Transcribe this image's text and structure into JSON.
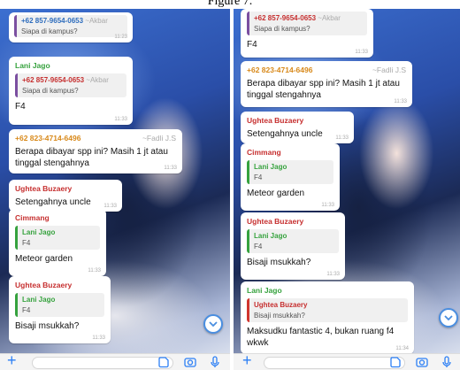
{
  "caption": "Figure 7.",
  "left_chat": {
    "messages": [
      {
        "quote_sender": "+62 857-9654-0653",
        "quote_alias": "~Akbar",
        "quote_text": "Siapa di kampus?",
        "time": "11:23"
      },
      {
        "sender": "Lani Jago",
        "quote_sender": "+62 857-9654-0653",
        "quote_alias": "~Akbar",
        "quote_text": "Siapa di kampus?",
        "text": "F4",
        "time": "11:33"
      },
      {
        "sender": "+62 823-4714-6496",
        "alias": "~Fadli J.S",
        "text": "Berapa dibayar spp ini? Masih 1 jt atau tinggal stengahnya",
        "time": "11:33"
      },
      {
        "sender": "Ughtea Buzaery",
        "text": "Setengahnya uncle",
        "time": "11:33"
      },
      {
        "sender": "Cimmang",
        "quote_sender": "Lani Jago",
        "quote_text": "F4",
        "text": "Meteor garden",
        "time": "11:33"
      },
      {
        "sender": "Ughtea Buzaery",
        "quote_sender": "Lani Jago",
        "quote_text": "F4",
        "text": "Bisaji msukkah?",
        "time": "11:33"
      }
    ]
  },
  "right_chat": {
    "messages": [
      {
        "quote_sender": "+62 857-9654-0653",
        "quote_alias": "~Akbar",
        "quote_text": "Siapa di kampus?",
        "text": "F4",
        "time": "11:33"
      },
      {
        "sender": "+62 823-4714-6496",
        "alias": "~Fadli J.S",
        "text": "Berapa dibayar spp ini? Masih 1 jt atau tinggal stengahnya",
        "time": "11:33"
      },
      {
        "sender": "Ughtea Buzaery",
        "text": "Setengahnya uncle",
        "time": "11:33"
      },
      {
        "sender": "Cimmang",
        "quote_sender": "Lani Jago",
        "quote_text": "F4",
        "text": "Meteor garden",
        "time": "11:33"
      },
      {
        "sender": "Ughtea Buzaery",
        "quote_sender": "Lani Jago",
        "quote_text": "F4",
        "text": "Bisaji msukkah?",
        "time": "11:33"
      },
      {
        "sender": "Lani Jago",
        "quote_sender": "Ughtea Buzaery",
        "quote_text": "Bisaji msukkah?",
        "text": "Maksudku fantastic 4, bukan ruang f4 wkwk",
        "time": "11:34"
      }
    ]
  },
  "icons": {
    "attach": "plus-icon",
    "sticker": "sticker-icon",
    "camera": "camera-icon",
    "mic": "microphone-icon",
    "scroll": "chevron-down-icon"
  },
  "colors": {
    "accent": "#2c7ff5",
    "sender_blue": "#2e6dbd",
    "sender_green": "#36a23e",
    "sender_orange": "#d8891a",
    "sender_red": "#c62f2f"
  }
}
